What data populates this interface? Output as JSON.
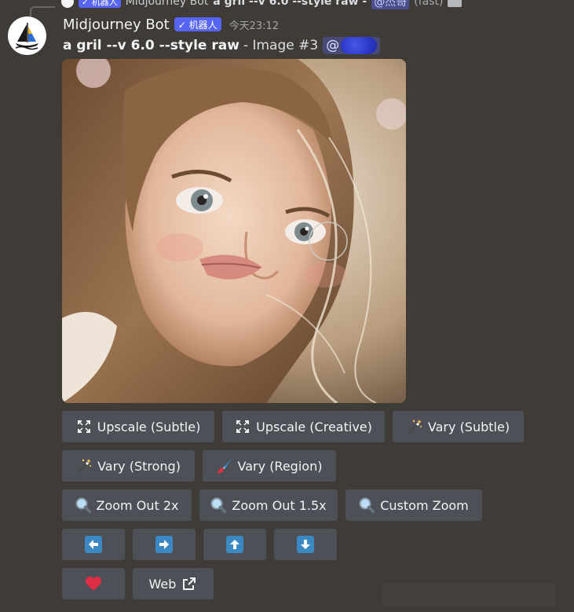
{
  "reply": {
    "badge": "✓ 机器人",
    "author": "Midjourney Bot",
    "text": "a gril --v 6.0 --style raw -",
    "mention": "@杰哥",
    "speed": "(fast)"
  },
  "message": {
    "author": "Midjourney Bot",
    "badge": "✓ 机器人",
    "timestamp": "今天23:12",
    "prompt": "a gril --v 6.0 --style raw",
    "suffix": "- Image #3",
    "mention": "@"
  },
  "buttons": {
    "row1": [
      "Upscale (Subtle)",
      "Upscale (Creative)",
      "Vary (Subtle)"
    ],
    "row2": [
      "Vary (Strong)",
      "Vary (Region)"
    ],
    "row3": [
      "Zoom Out 2x",
      "Zoom Out 1.5x",
      "Custom Zoom"
    ],
    "web": "Web"
  },
  "colors": {
    "background": "#3f3b37",
    "button": "#4e5058",
    "badge": "#5865f2",
    "arrow": "#3b88c3",
    "heart": "#dd2e44"
  },
  "icons": {
    "upscale": "expand-icon",
    "vary_subtle": "magic-wand-icon",
    "vary_region": "paintbrush-icon",
    "zoom": "magnifier-icon",
    "arrows": [
      "arrow-left-icon",
      "arrow-right-icon",
      "arrow-up-icon",
      "arrow-down-icon"
    ],
    "like": "heart-icon",
    "web": "external-link-icon"
  }
}
